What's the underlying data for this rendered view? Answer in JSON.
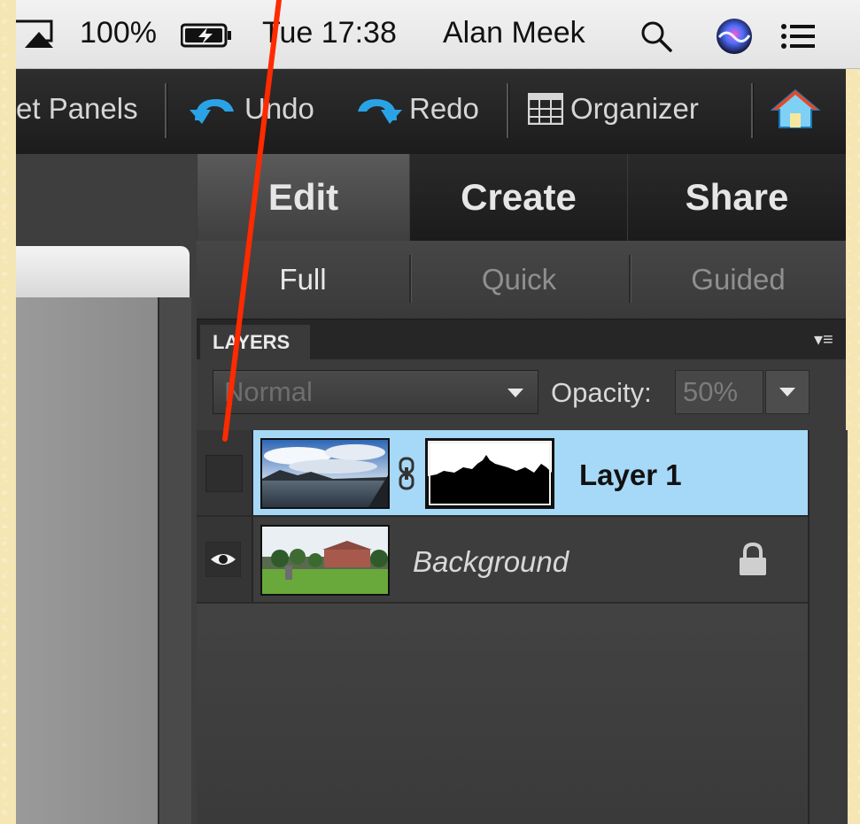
{
  "menubar": {
    "battery": "100%",
    "clock": "Tue 17:38",
    "user": "Alan Meek",
    "icons": [
      "airplay-icon",
      "battery-charging-icon",
      "search-icon",
      "siri-icon",
      "notification-list-icon"
    ]
  },
  "toolbar": {
    "panels_label": "et Panels",
    "undo_label": "Undo",
    "redo_label": "Redo",
    "organizer_label": "Organizer",
    "icons": [
      "undo-icon",
      "redo-icon",
      "organizer-icon",
      "home-icon"
    ]
  },
  "mode_tabs": [
    {
      "label": "Edit",
      "active": true
    },
    {
      "label": "Create",
      "active": false
    },
    {
      "label": "Share",
      "active": false
    }
  ],
  "sub_tabs": [
    {
      "label": "Full",
      "active": true
    },
    {
      "label": "Quick",
      "active": false
    },
    {
      "label": "Guided",
      "active": false
    }
  ],
  "layers_panel": {
    "title": "LAYERS",
    "blend_mode": "Normal",
    "opacity_label": "Opacity:",
    "opacity_value": "50%",
    "layers": [
      {
        "name": "Layer 1",
        "selected": true,
        "visible": false,
        "has_mask": true
      },
      {
        "name": "Background",
        "selected": false,
        "visible": true,
        "locked": true
      }
    ]
  },
  "colors": {
    "background": "#f6e6b4",
    "selection": "#a6d8f8",
    "annotation": "#ff2a00",
    "accent_blue": "#2aa3e6"
  }
}
